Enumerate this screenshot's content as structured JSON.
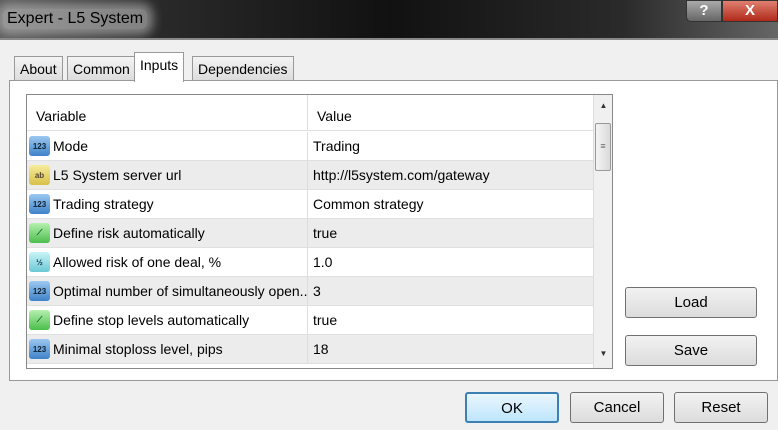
{
  "window": {
    "title": "Expert - L5 System",
    "help_label": "?",
    "close_label": "X"
  },
  "tabs": [
    {
      "label": "About"
    },
    {
      "label": "Common"
    },
    {
      "label": "Inputs"
    },
    {
      "label": "Dependencies"
    }
  ],
  "table": {
    "headers": {
      "variable": "Variable",
      "value": "Value"
    },
    "rows": [
      {
        "type": "int",
        "icon_text": "123",
        "variable": "Mode",
        "value": "Trading"
      },
      {
        "type": "str",
        "icon_text": "ab",
        "variable": "L5 System server url",
        "value": "http://l5system.com/gateway"
      },
      {
        "type": "int",
        "icon_text": "123",
        "variable": "Trading strategy",
        "value": "Common strategy"
      },
      {
        "type": "bool",
        "icon_text": "⟋",
        "variable": "Define risk automatically",
        "value": "true"
      },
      {
        "type": "dbl",
        "icon_text": "½",
        "variable": "Allowed risk of one deal, %",
        "value": "1.0"
      },
      {
        "type": "int",
        "icon_text": "123",
        "variable": "Optimal number of simultaneously open...",
        "value": "3"
      },
      {
        "type": "bool",
        "icon_text": "⟋",
        "variable": "Define stop levels automatically",
        "value": "true"
      },
      {
        "type": "int",
        "icon_text": "123",
        "variable": "Minimal stoploss level, pips",
        "value": "18"
      }
    ]
  },
  "buttons": {
    "load": "Load",
    "save": "Save",
    "ok": "OK",
    "cancel": "Cancel",
    "reset": "Reset"
  }
}
